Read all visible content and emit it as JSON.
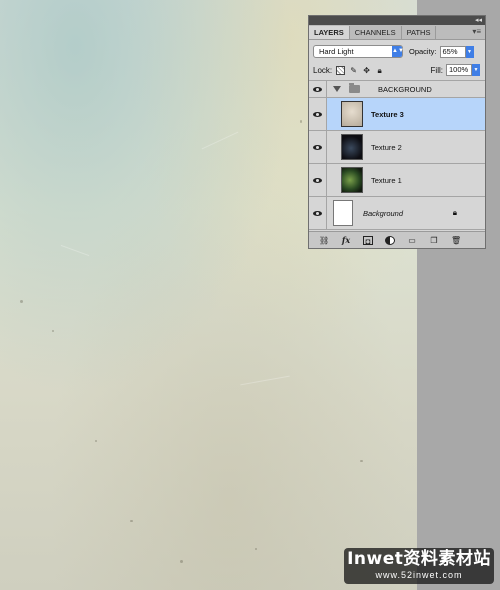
{
  "panel": {
    "collapse_glyph": "◂◂",
    "menu_glyph": "▾≡",
    "tabs": [
      {
        "label": "LAYERS",
        "active": true
      },
      {
        "label": "CHANNELS",
        "active": false
      },
      {
        "label": "PATHS",
        "active": false
      }
    ],
    "blend_mode": "Hard Light",
    "opacity_label": "Opacity:",
    "opacity_value": "65%",
    "lock_label": "Lock:",
    "fill_label": "Fill:",
    "fill_value": "100%",
    "group": {
      "name": "BACKGROUND"
    },
    "layers": [
      {
        "name": "Texture 3",
        "selected": true
      },
      {
        "name": "Texture 2",
        "selected": false
      },
      {
        "name": "Texture 1",
        "selected": false
      }
    ],
    "background_layer": {
      "name": "Background"
    }
  },
  "watermark": {
    "main": "Inwet资料素材站",
    "sub": "www.52inwet.com"
  },
  "colors": {
    "selection": "#b7d5fa",
    "accent": "#3f7ee6"
  }
}
